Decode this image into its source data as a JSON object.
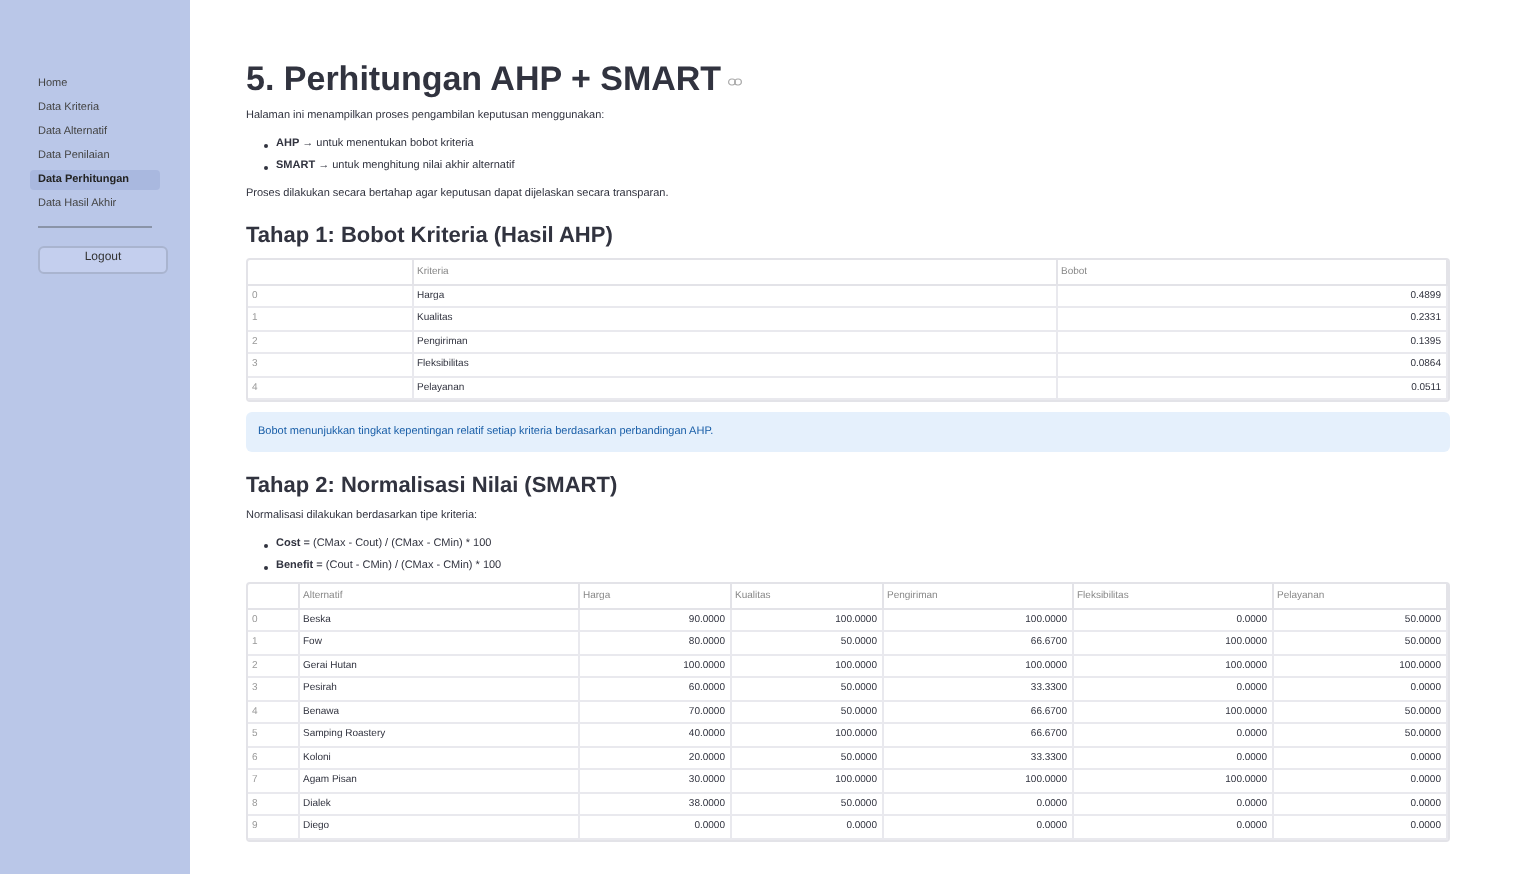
{
  "sidebar": {
    "items": [
      {
        "label": "Home",
        "selected": false
      },
      {
        "label": "Data Kriteria",
        "selected": false
      },
      {
        "label": "Data Alternatif",
        "selected": false
      },
      {
        "label": "Data Penilaian",
        "selected": false
      },
      {
        "label": "Data Perhitungan",
        "selected": true
      },
      {
        "label": "Data Hasil Akhir",
        "selected": false
      }
    ],
    "logout": "Logout"
  },
  "title": "5. Perhitungan AHP + SMART",
  "intro": "Halaman ini menampilkan proses pengambilan keputusan menggunakan:",
  "intro_bullets": [
    "**AHP** → untuk menentukan bobot kriteria",
    "**SMART** → untuk menghitung nilai akhir alternatif"
  ],
  "intro_note": "Proses dilakukan secara bertahap agar keputusan dapat dijelaskan secara transparan.",
  "step1": {
    "heading": "Tahap 1: Bobot Kriteria (Hasil AHP)",
    "table": {
      "columns": [
        "",
        "Kriteria",
        "Bobot"
      ],
      "rows": [
        [
          "0",
          "Harga",
          "0.4899"
        ],
        [
          "1",
          "Kualitas",
          "0.2331"
        ],
        [
          "2",
          "Pengiriman",
          "0.1395"
        ],
        [
          "3",
          "Fleksibilitas",
          "0.0864"
        ],
        [
          "4",
          "Pelayanan",
          "0.0511"
        ]
      ]
    },
    "info": "Bobot menunjukkan tingkat kepentingan relatif setiap kriteria berdasarkan perbandingan AHP."
  },
  "step2": {
    "heading": "Tahap 2: Normalisasi Nilai (SMART)",
    "text": "Normalisasi dilakukan berdasarkan tipe kriteria:",
    "bullets": [
      "**Cost** = (CMax - Cout) / (CMax - CMin) * 100",
      "**Benefit** = (Cout - CMin) / (CMax - CMin) * 100"
    ],
    "table": {
      "columns": [
        "",
        "Alternatif",
        "Harga",
        "Kualitas",
        "Pengiriman",
        "Fleksibilitas",
        "Pelayanan"
      ],
      "rows": [
        [
          "0",
          "Beska",
          "90.0000",
          "100.0000",
          "100.0000",
          "0.0000",
          "50.0000"
        ],
        [
          "1",
          "Fow",
          "80.0000",
          "50.0000",
          "66.6700",
          "100.0000",
          "50.0000"
        ],
        [
          "2",
          "Gerai Hutan",
          "100.0000",
          "100.0000",
          "100.0000",
          "100.0000",
          "100.0000"
        ],
        [
          "3",
          "Pesirah",
          "60.0000",
          "50.0000",
          "33.3300",
          "0.0000",
          "0.0000"
        ],
        [
          "4",
          "Benawa",
          "70.0000",
          "50.0000",
          "66.6700",
          "100.0000",
          "50.0000"
        ],
        [
          "5",
          "Samping Roastery",
          "40.0000",
          "100.0000",
          "66.6700",
          "0.0000",
          "50.0000"
        ],
        [
          "6",
          "Koloni",
          "20.0000",
          "50.0000",
          "33.3300",
          "0.0000",
          "0.0000"
        ],
        [
          "7",
          "Agam Pisan",
          "30.0000",
          "100.0000",
          "100.0000",
          "100.0000",
          "0.0000"
        ],
        [
          "8",
          "Dialek",
          "38.0000",
          "50.0000",
          "0.0000",
          "0.0000",
          "0.0000"
        ],
        [
          "9",
          "Diego",
          "0.0000",
          "0.0000",
          "0.0000",
          "0.0000",
          "0.0000"
        ]
      ]
    }
  }
}
